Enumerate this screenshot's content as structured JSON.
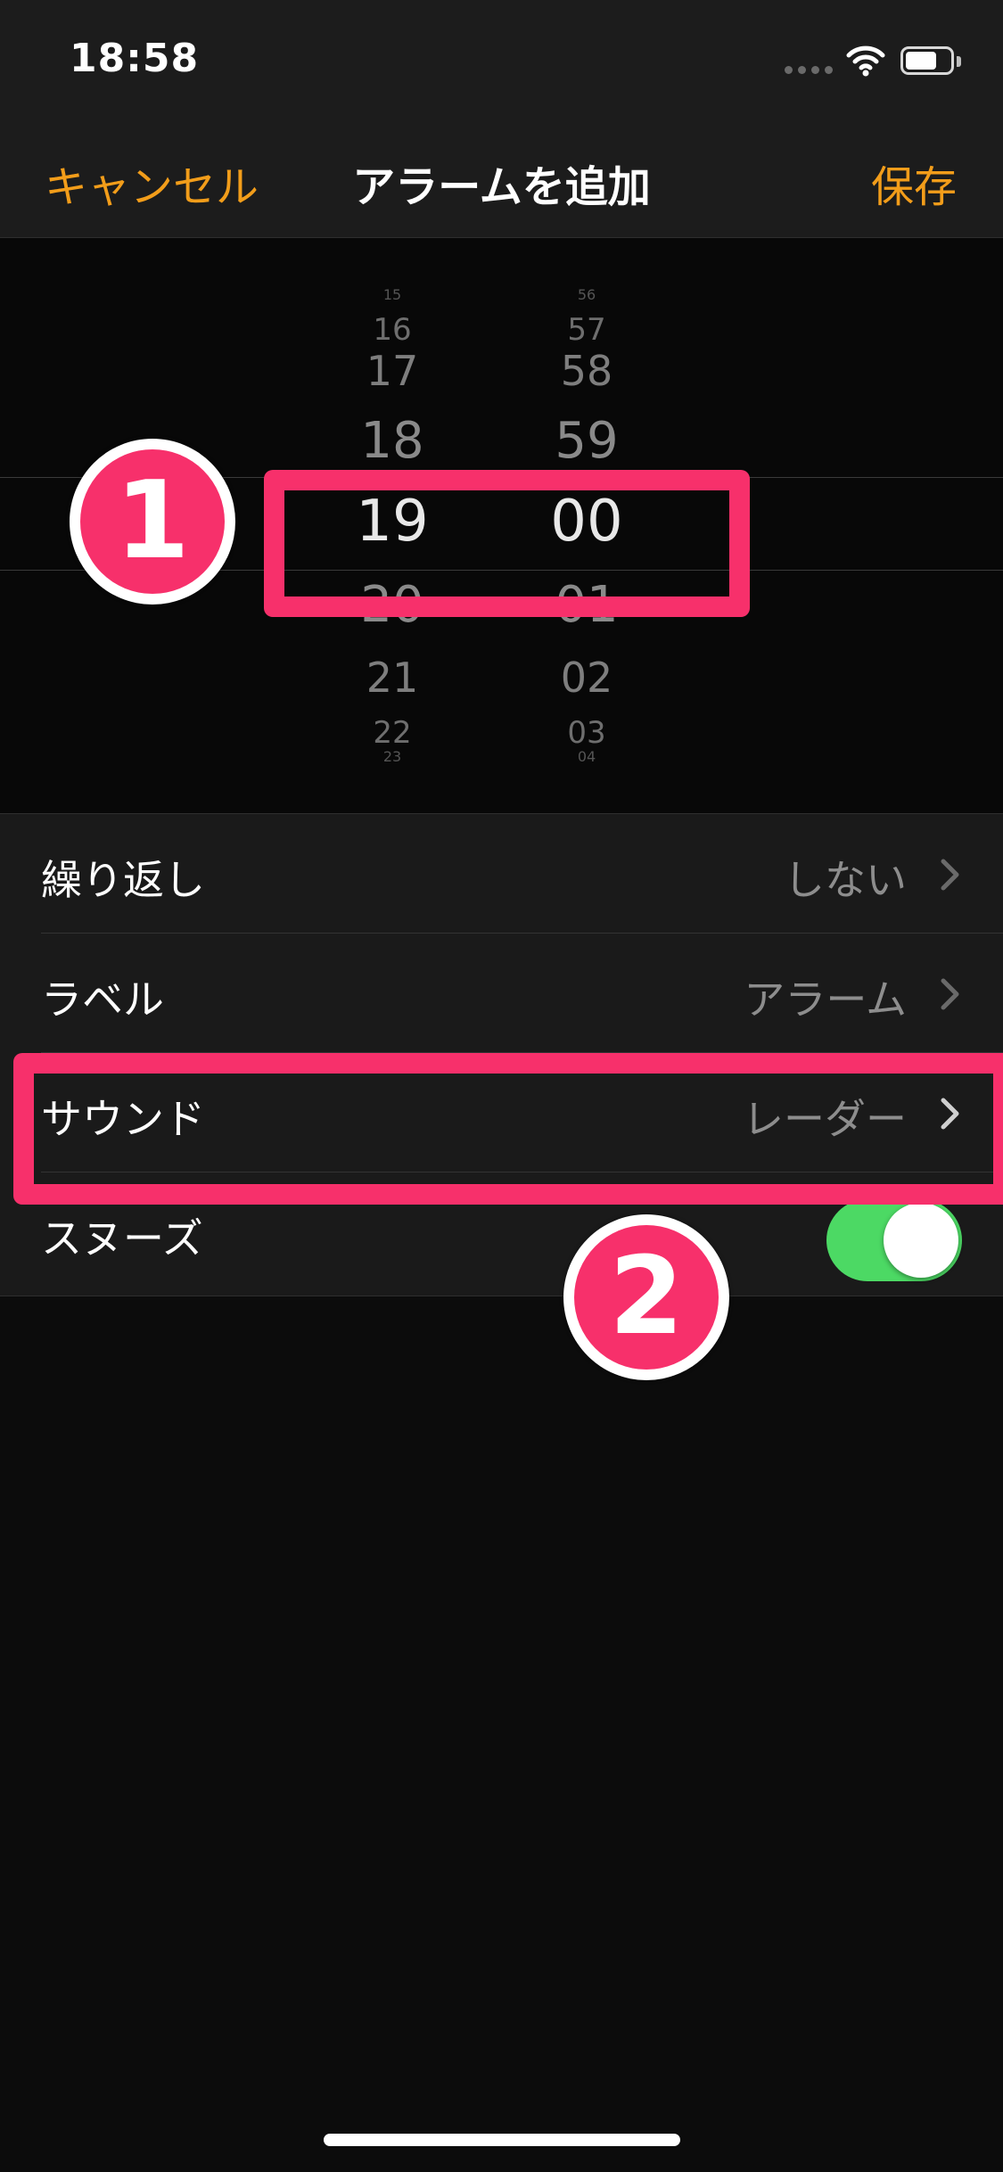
{
  "status_bar": {
    "time": "18:58"
  },
  "nav": {
    "cancel": "キャンセル",
    "title": "アラームを追加",
    "save": "保存"
  },
  "picker": {
    "hours": [
      "15",
      "16",
      "17",
      "18",
      "19",
      "20",
      "21",
      "22",
      "23"
    ],
    "minutes": [
      "56",
      "57",
      "58",
      "59",
      "00",
      "01",
      "02",
      "03",
      "04"
    ],
    "selected_hour": "19",
    "selected_minute": "00"
  },
  "settings": [
    {
      "label": "繰り返し",
      "value": "しない"
    },
    {
      "label": "ラベル",
      "value": "アラーム"
    },
    {
      "label": "サウンド",
      "value": "レーダー"
    },
    {
      "label": "スヌーズ",
      "toggle_on": true
    }
  ],
  "annotations": {
    "badge1": "1",
    "badge2": "2"
  },
  "colors": {
    "accent": "#f29d1a",
    "highlight": "#f7306b",
    "toggle_on": "#4cd964"
  }
}
